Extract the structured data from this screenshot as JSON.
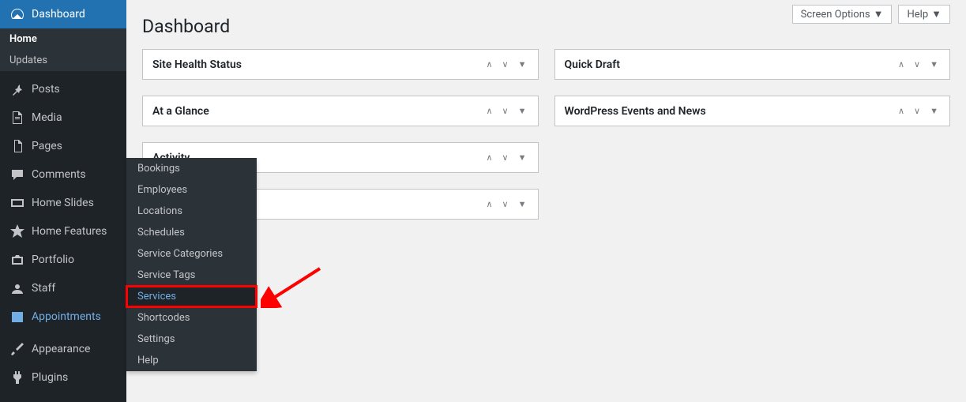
{
  "topButtons": {
    "screenOptions": "Screen Options",
    "help": "Help"
  },
  "pageTitle": "Dashboard",
  "sidebar": {
    "dashboard": "Dashboard",
    "home": "Home",
    "updates": "Updates",
    "posts": "Posts",
    "media": "Media",
    "pages": "Pages",
    "comments": "Comments",
    "homeSlides": "Home Slides",
    "homeFeatures": "Home Features",
    "portfolio": "Portfolio",
    "staff": "Staff",
    "appointments": "Appointments",
    "appearance": "Appearance",
    "plugins": "Plugins"
  },
  "flyout": {
    "bookings": "Bookings",
    "employees": "Employees",
    "locations": "Locations",
    "schedules": "Schedules",
    "serviceCategories": "Service Categories",
    "serviceTags": "Service Tags",
    "services": "Services",
    "shortcodes": "Shortcodes",
    "settings": "Settings",
    "help": "Help"
  },
  "widgets": {
    "siteHealth": "Site Health Status",
    "atAGlance": "At a Glance",
    "activity": "Activity",
    "quickDraft": "Quick Draft",
    "wpEvents": "WordPress Events and News"
  }
}
